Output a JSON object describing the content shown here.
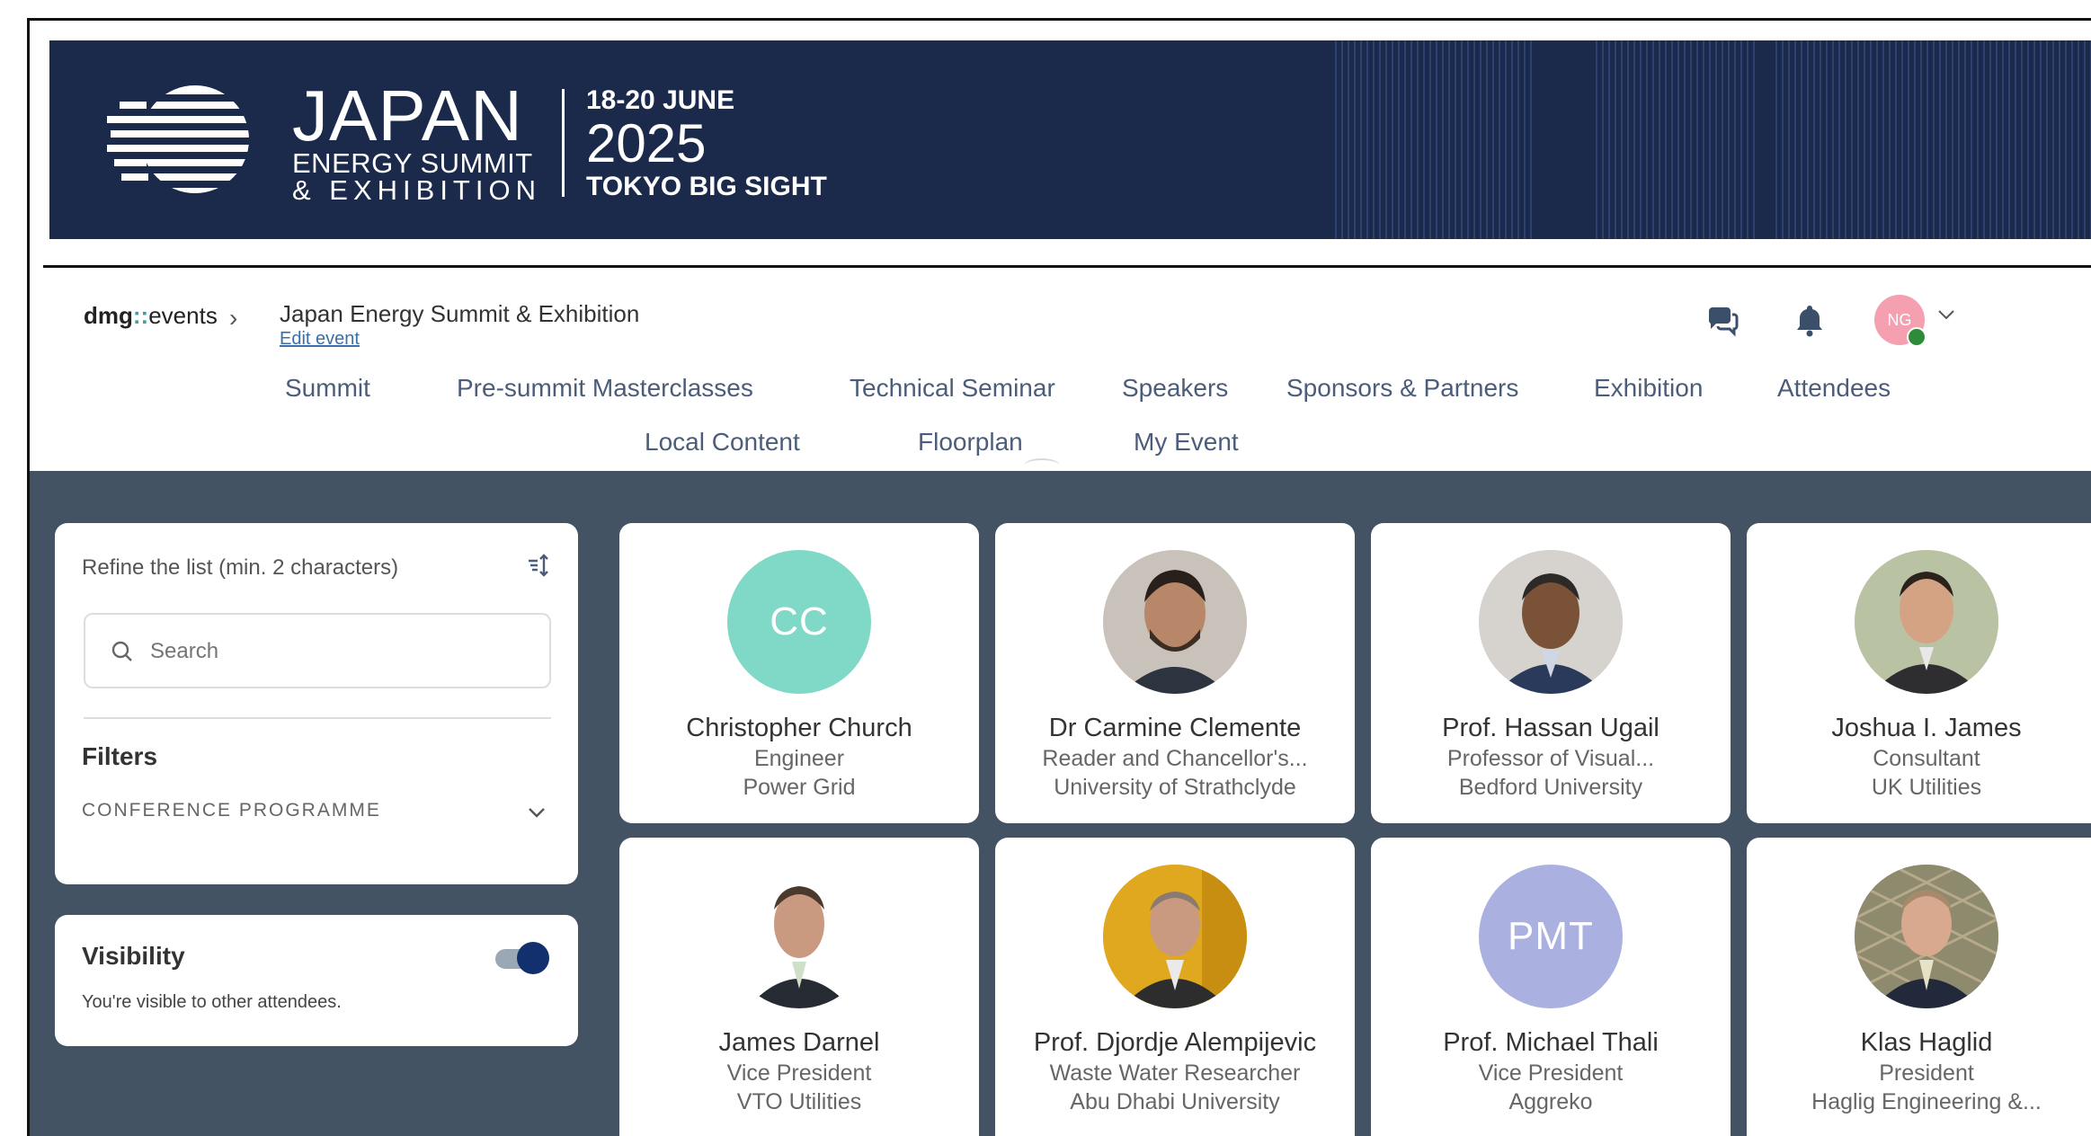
{
  "banner": {
    "brand_big": "JAPAN",
    "brand_line1": "ENERGY SUMMIT",
    "brand_line2": "& EXHIBITION",
    "dates": "18-20 JUNE",
    "year": "2025",
    "venue": "TOKYO BIG SIGHT"
  },
  "header": {
    "platform_bold": "dmg",
    "platform_dots": "::",
    "platform_rest": "events",
    "breadcrumb_chevron": "›",
    "event_title": "Japan Energy Summit & Exhibition",
    "edit_link": "Edit event",
    "icons": [
      "chat-icon",
      "bell-icon",
      "chevron-down-icon"
    ],
    "user_initials": "NG"
  },
  "nav": {
    "row1": [
      "Summit",
      "Pre-summit Masterclasses",
      "Technical Seminar",
      "Speakers",
      "Sponsors & Partners",
      "Exhibition",
      "Attendees"
    ],
    "row2": [
      "Local Content",
      "Floorplan",
      "My Event"
    ]
  },
  "sidebar": {
    "refine_label": "Refine the list (min. 2 characters)",
    "search_placeholder": "Search",
    "filters_title": "Filters",
    "conference_programme": "CONFERENCE PROGRAMME",
    "visibility_title": "Visibility",
    "visibility_desc": "You're visible to other attendees.",
    "visibility_on": true
  },
  "attendees": [
    {
      "name": "Christopher Church",
      "role": "Engineer",
      "org": "Power Grid",
      "initials": "CC",
      "avatar_color": "#7fd9c6"
    },
    {
      "name": "Dr Carmine Clemente",
      "role": "Reader and Chancellor's...",
      "org": "University of Strathclyde",
      "initials": "",
      "avatar_color": "#4a3a33"
    },
    {
      "name": "Prof. Hassan Ugail",
      "role": "Professor of Visual...",
      "org": "Bedford University",
      "initials": "",
      "avatar_color": "#5d4b42"
    },
    {
      "name": "Joshua I. James",
      "role": "Consultant",
      "org": "UK Utilities",
      "initials": "",
      "avatar_color": "#6b5a4a"
    },
    {
      "name": "James Darnel",
      "role": "Vice President",
      "org": "VTO Utilities",
      "initials": "",
      "avatar_color": "#b9a493"
    },
    {
      "name": "Prof. Djordje Alempijevic",
      "role": "Waste Water Researcher",
      "org": "Abu Dhabi University",
      "initials": "",
      "avatar_color": "#d8a422"
    },
    {
      "name": "Prof. Michael Thali",
      "role": "Vice President",
      "org": "Aggreko",
      "initials": "PMT",
      "avatar_color": "#aab0e0"
    },
    {
      "name": "Klas Haglid",
      "role": "President",
      "org": "Haglig Engineering &...",
      "initials": "",
      "avatar_color": "#7b8a6a"
    }
  ]
}
